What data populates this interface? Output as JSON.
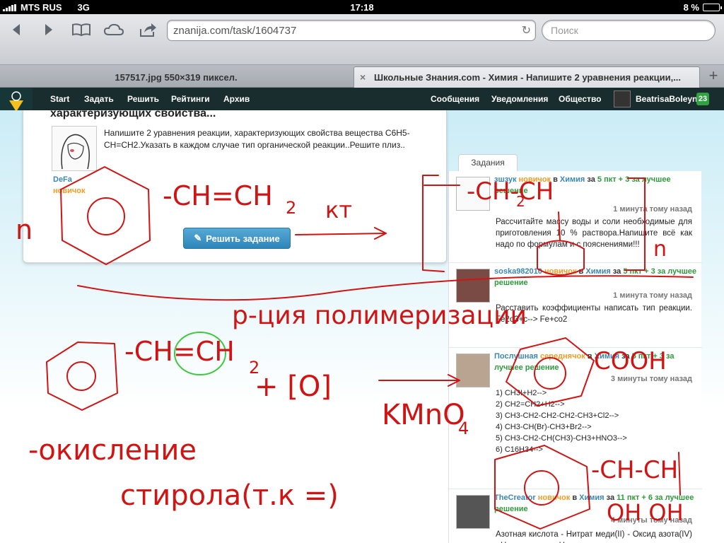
{
  "status_bar": {
    "carrier": "MTS RUS",
    "network": "3G",
    "time": "17:18",
    "battery": "8 %"
  },
  "browser": {
    "url": "znanija.com/task/1604737",
    "search_placeholder": "Поиск",
    "tabs": [
      {
        "label": "157517.jpg 550×319 пиксел."
      },
      {
        "label": "Школьные Знания.com - Химия - Напишите 2 уравнения реакции,..."
      }
    ],
    "new_tab": "+",
    "close_tab": "×"
  },
  "site_nav": {
    "left": [
      "Start",
      "Задать",
      "Решить",
      "Рейтинги",
      "Архив"
    ],
    "right": [
      "Сообщения",
      "Уведомления",
      "Общество"
    ],
    "user": "BeatrisaBoleyn",
    "count": "23"
  },
  "task": {
    "title": "характеризующих свойства...",
    "text": "Напишите 2 уравнения реакции, характеризующих свойства вещества C6H5-CH=CH2.Указать в каждом случае тип органической реакции..Решите плиз..",
    "author": "DeFa",
    "rank": "новичок",
    "solve_button": "Решить задание"
  },
  "sidebar": {
    "tab_label": "Задания",
    "items": [
      {
        "user": "зшзук",
        "rank": "новичок",
        "in": "в",
        "subject": "Химия",
        "za": "за",
        "points": "5 пкт + 3 за лучшее решение",
        "time": "1 минута тому назад",
        "text": "Рассчитайте массу воды и соли необходимые для приготовления 10 % раствора.Напишите всё как надо по формулам и с пояснениями!!!"
      },
      {
        "user": "soska982010",
        "rank": "новичок",
        "in": "в",
        "subject": "Химия",
        "za": "за",
        "points": "5 пкт + 3 за лучшее решение",
        "time": "1 минута тому назад",
        "text": "Расставить коэффициенты написать тип реакции. Fe2o3+c--> Fe+co2"
      },
      {
        "user": "Послушная",
        "rank": "середнячок",
        "in": "в",
        "subject": "Химия",
        "za": "за",
        "points": "5 пкт + 3 за лучшее решение",
        "time": "3 минуты тому назад",
        "lines": [
          "1) CH3I+H2-->",
          "2) CH2=CH2+H2-->",
          "3) CH3-CH2-CH2-CH2-CH3+Cl2-->",
          "4) CH3-CH(Br)-CH3+Br2-->",
          "5) CH3-CH2-CH(CH3)-CH3+HNO3-->",
          "6) C16H34-->"
        ]
      },
      {
        "user": "TheCreator",
        "rank": "новичок",
        "in": "в",
        "subject": "Химия",
        "za": "за",
        "points": "11 пкт + 6 за лучшее решение",
        "time": "4 минуты тому назад",
        "text": "Азотная кислота - Нитрат меди(II) - Оксид азота(IV) - Нитрит калия - Нитрат калия -"
      }
    ]
  },
  "ink": {
    "n1": "n",
    "group1": "-CH=CH",
    "sub2a": "2",
    "kt": "кт",
    "bracket_top": "-CH-CH",
    "sub2b": "2",
    "n2": "n",
    "reaction1": "р-ция полимеризации",
    "group2": "-CH=CH",
    "sub2c": "2",
    "plus_o": "+ [O]",
    "kmno": "KMnO",
    "sub4": "4",
    "cooh": "COOH",
    "oxid": "-окисление",
    "styrene": "стирола(т.к =)",
    "diol_top": "-CH-CH",
    "diol_bottom": "OH OH"
  },
  "colors": {
    "ink_red": "#d01414",
    "ink_green": "#3ec83e",
    "nav_bg": "#1a2d2e",
    "accent_blue": "#3a86b5",
    "rank_orange": "#f29d22",
    "points_green": "#2e9a3c"
  }
}
